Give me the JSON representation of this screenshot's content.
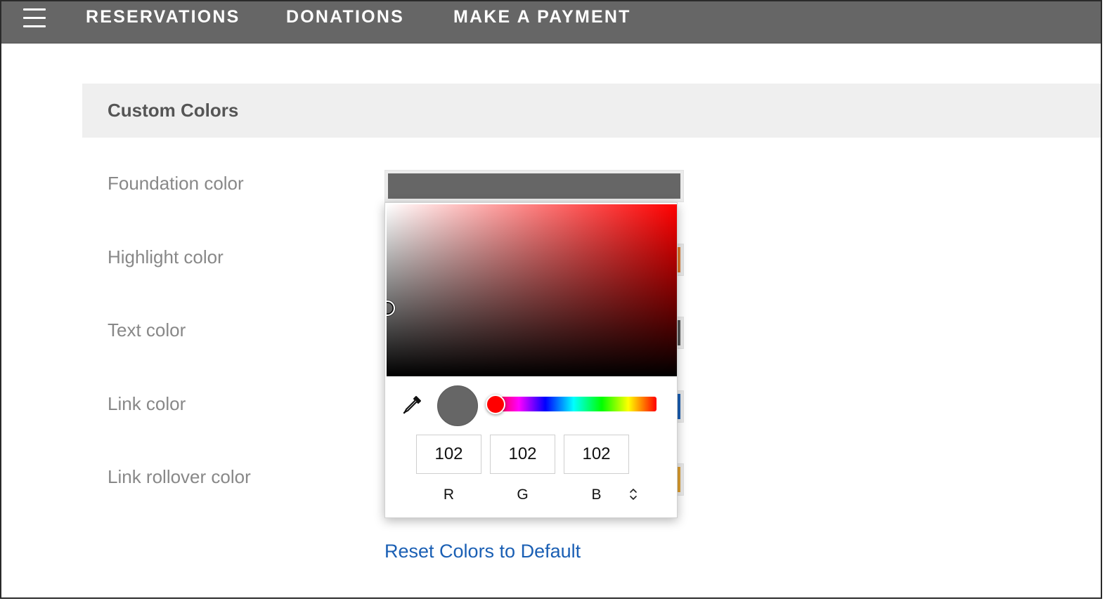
{
  "nav": {
    "items": [
      {
        "label": "RESERVATIONS"
      },
      {
        "label": "DONATIONS"
      },
      {
        "label": "MAKE A PAYMENT"
      }
    ]
  },
  "section": {
    "title": "Custom Colors"
  },
  "rows": [
    {
      "label": "Foundation color",
      "color": "#666666"
    },
    {
      "label": "Highlight color",
      "color": "#e07a2c"
    },
    {
      "label": "Text color",
      "color": "#555555"
    },
    {
      "label": "Link color",
      "color": "#1a5fb4"
    },
    {
      "label": "Link rollover color",
      "color": "#e0a030"
    }
  ],
  "picker": {
    "hue_color": "#ff0000",
    "preview_color": "#666666",
    "r": "102",
    "g": "102",
    "b": "102",
    "r_label": "R",
    "g_label": "G",
    "b_label": "B",
    "eyedropper_icon": "eyedropper-icon",
    "toggle_icon": "up-down-chevron-icon"
  },
  "reset_link": "Reset Colors to Default"
}
